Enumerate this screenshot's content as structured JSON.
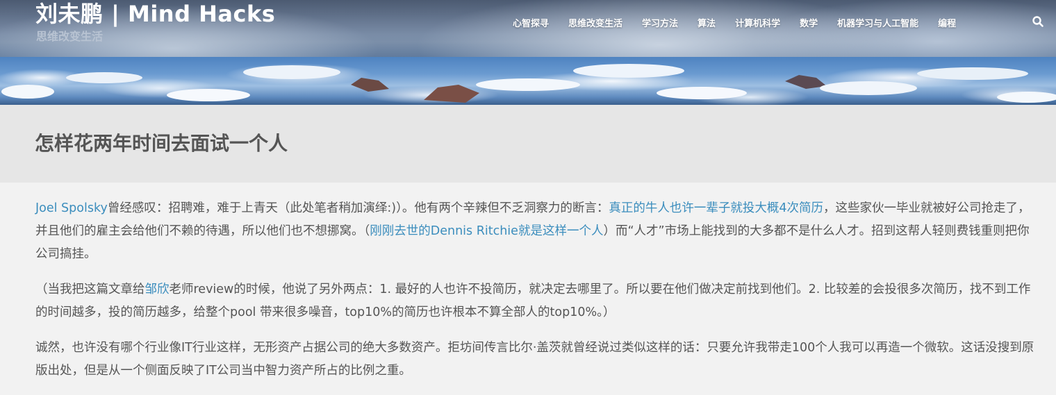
{
  "site": {
    "title": "刘未鹏 | Mind Hacks",
    "tagline": "思维改变生活"
  },
  "nav": {
    "items": [
      {
        "label": "心智探寻"
      },
      {
        "label": "思维改变生活"
      },
      {
        "label": "学习方法"
      },
      {
        "label": "算法"
      },
      {
        "label": "计算机科学"
      },
      {
        "label": "数学"
      },
      {
        "label": "机器学习与人工智能"
      },
      {
        "label": "编程"
      }
    ],
    "search_icon": "search-icon"
  },
  "article": {
    "title": "怎样花两年时间去面试一个人",
    "p1": {
      "link1": "Joel Spolsky",
      "t1": "曾经感叹：招聘难，难于上青天（此处笔者稍加演绎:)）。他有两个辛辣但不乏洞察力的断言：",
      "link2": "真正的牛人也许一辈子就投大概4次简历",
      "t2": "，这些家伙一毕业就被好公司抢走了，并且他们的雇主会给他们不赖的待遇，所以他们也不想挪窝。（",
      "link3": "刚刚去世的Dennis Ritchie就是这样一个人",
      "t3": "）而“人才”市场上能找到的大多都不是什么人才。招到这帮人轻则费钱重则把你公司搞挂。"
    },
    "p2": {
      "t1": "（当我把这篇文章给",
      "link1": "邹欣",
      "t2": "老师review的时候，他说了另外两点：1. 最好的人也许不投简历，就决定去哪里了。所以要在他们做决定前找到他们。2. 比较差的会投很多次简历，找不到工作的时间越多，投的简历越多，给整个pool 带来很多噪音，top10%的简历也许根本不算全部人的top10%。）"
    },
    "p3": {
      "t1": "诚然，也许没有哪个行业像IT行业这样，无形资产占据公司的绝大多数资产。拒坊间传言比尔·盖茨就曾经说过类似这样的话：只要允许我带走100个人我可以再造一个微软。这话没搜到原版出处，但是从一个侧面反映了IT公司当中智力资产所占的比例之重。"
    }
  },
  "colors": {
    "link": "#3b8dbd",
    "text": "#555555",
    "title_band": "#e6e6e6",
    "page_bg": "#f2f2f2"
  }
}
